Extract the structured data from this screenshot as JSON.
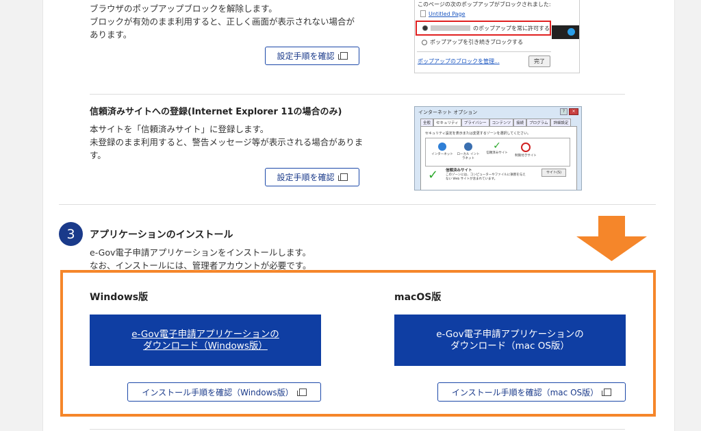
{
  "popup_section": {
    "text_lines": [
      "ブラウザのポップアップブロックを解除します。",
      "ブロックが有効のまま利用すると、正しく画面が表示されない場合が",
      "あります。"
    ],
    "button_label": "設定手順を確認",
    "dialog": {
      "header": "このページの次のポップアップがブロックされました:",
      "page_link": "Untitled Page",
      "allow_option": "のポップアップを常に許可する",
      "block_option": "ポップアップを引き続きブロックする",
      "manage_link": "ポップアップのブロックを管理...",
      "done_button": "完了"
    }
  },
  "trusted_section": {
    "title": "信頼済みサイトへの登録(Internet Explorer 11の場合のみ)",
    "text_lines": [
      "本サイトを「信頼済みサイト」に登録します。",
      "未登録のまま利用すると、警告メッセージ等が表示される場合がありま",
      "す。"
    ],
    "button_label": "設定手順を確認",
    "dialog": {
      "title": "インターネット オプション",
      "tabs": [
        "全般",
        "セキュリティ",
        "プライバシー",
        "コンテンツ",
        "接続",
        "プログラム",
        "詳細設定"
      ],
      "zone_prompt": "セキュリティ設定を表示または変更するゾーンを選択してください。",
      "zones": [
        "インターネット",
        "ローカル イントラネット",
        "信頼済みサイト",
        "制限付きサイト"
      ],
      "trusted_title": "信頼済みサイト",
      "trusted_desc": "このゾーンには、コンピューターやファイルに損害を与えない Web サイトが含まれています。",
      "sites_button": "サイト(S)"
    }
  },
  "install_section": {
    "step_number": "3",
    "title": "アプリケーションのインストール",
    "text_lines": [
      "e-Gov電子申請アプリケーションをインストールします。",
      "なお、インストールには、管理者アカウントが必要です。"
    ],
    "windows": {
      "heading": "Windows版",
      "download_line1": "e-Gov電子申請アプリケーションの",
      "download_line2": "ダウンロード（Windows版）",
      "guide_label": "インストール手順を確認（Windows版）"
    },
    "mac": {
      "heading": "macOS版",
      "download_line1": "e-Gov電子申請アプリケーションの",
      "download_line2": "ダウンロード（mac OS版）",
      "guide_label": "インストール手順を確認（mac OS版）"
    }
  },
  "colors": {
    "highlight": "#f5862a",
    "primary": "#0f3ea3",
    "step_circle": "#1a3a8a"
  }
}
